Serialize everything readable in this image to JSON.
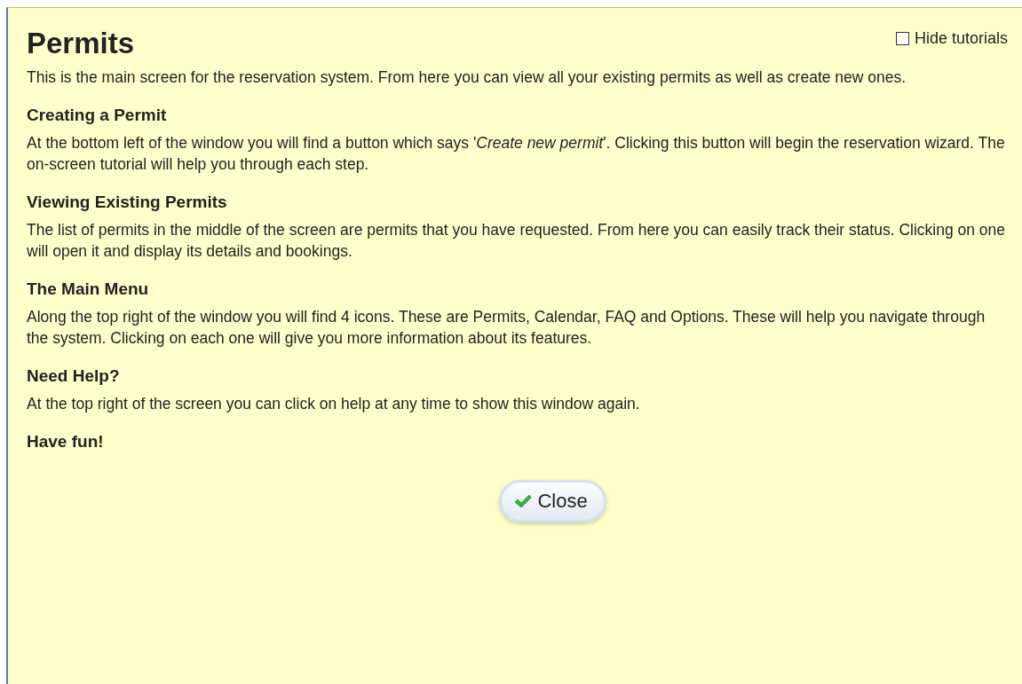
{
  "title": "Permits",
  "hide_tutorials": {
    "label": "Hide tutorials",
    "checked": false
  },
  "intro": "This is the main screen for the reservation system. From here you can view all your existing permits as well as create new ones.",
  "sections": [
    {
      "heading": "Creating a Permit",
      "body": "At the bottom left of the window you will find a button which says '*Create new permit*'. Clicking this button will begin the reservation wizard. The on-screen tutorial will help you through each step."
    },
    {
      "heading": "Viewing Existing Permits",
      "body": "The list of permits in the middle of the screen are permits that you have requested. From here you can easily track their status. Clicking on one will open it and display its details and bookings."
    },
    {
      "heading": "The Main Menu",
      "body": "Along the top right of the window you will find 4 icons. These are Permits, Calendar, FAQ and Options. These will help you navigate through the system. Clicking on each one will give you more information about its features."
    },
    {
      "heading": "Need Help?",
      "body": "At the top right of the screen you can click on help at any time to show this window again."
    },
    {
      "heading": "Have fun!"
    }
  ],
  "close_button": "Close"
}
